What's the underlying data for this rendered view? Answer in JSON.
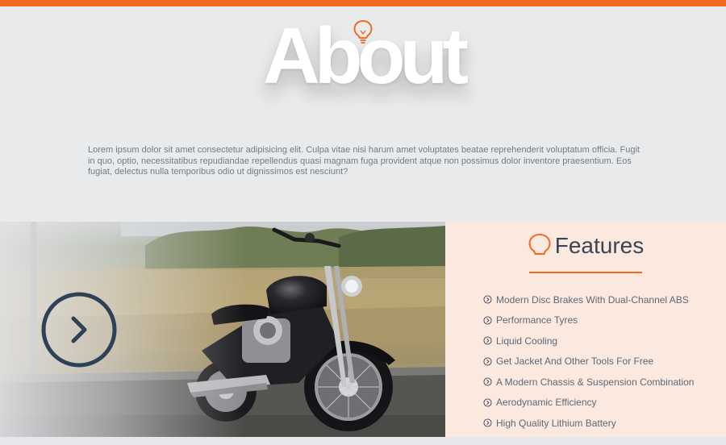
{
  "about": {
    "title": "About",
    "icon": "lightbulb-icon",
    "body": "Lorem ipsum dolor sit amet consectetur adipisicing elit. Culpa vitae nisi harum amet voluptates beatae reprehenderit voluptatum officia. Fugit in quo, optio, necessitatibus repudiandae repellendus quasi magnam fuga provident atque non possimus dolor inventore praesentium. Eos fugiat, delectus nulla temporibus odio ut dignissimos est nesciunt?"
  },
  "photo": {
    "subject": "motorcycle",
    "next_icon": "chevron-right-icon"
  },
  "features": {
    "title": "Features",
    "icon": "lightbulb-icon",
    "items": [
      {
        "label": "Modern Disc Brakes With Dual-Channel ABS",
        "icon": "chevron-circle-right-icon"
      },
      {
        "label": "Performance Tyres",
        "icon": "chevron-circle-right-icon"
      },
      {
        "label": "Liquid Cooling",
        "icon": "chevron-circle-right-icon"
      },
      {
        "label": "Get Jacket And Other Tools For Free",
        "icon": "chevron-circle-right-icon"
      },
      {
        "label": "A Modern Chassis & Suspension Combination",
        "icon": "chevron-circle-right-icon"
      },
      {
        "label": "Aerodynamic Efficiency",
        "icon": "chevron-circle-right-icon"
      },
      {
        "label": "High Quality Lithium Battery",
        "icon": "chevron-circle-right-icon"
      }
    ]
  },
  "colors": {
    "accent": "#f26a21",
    "navy": "#2f4156",
    "features_bg": "#fbe8df",
    "page_bg": "#e9eaec"
  }
}
